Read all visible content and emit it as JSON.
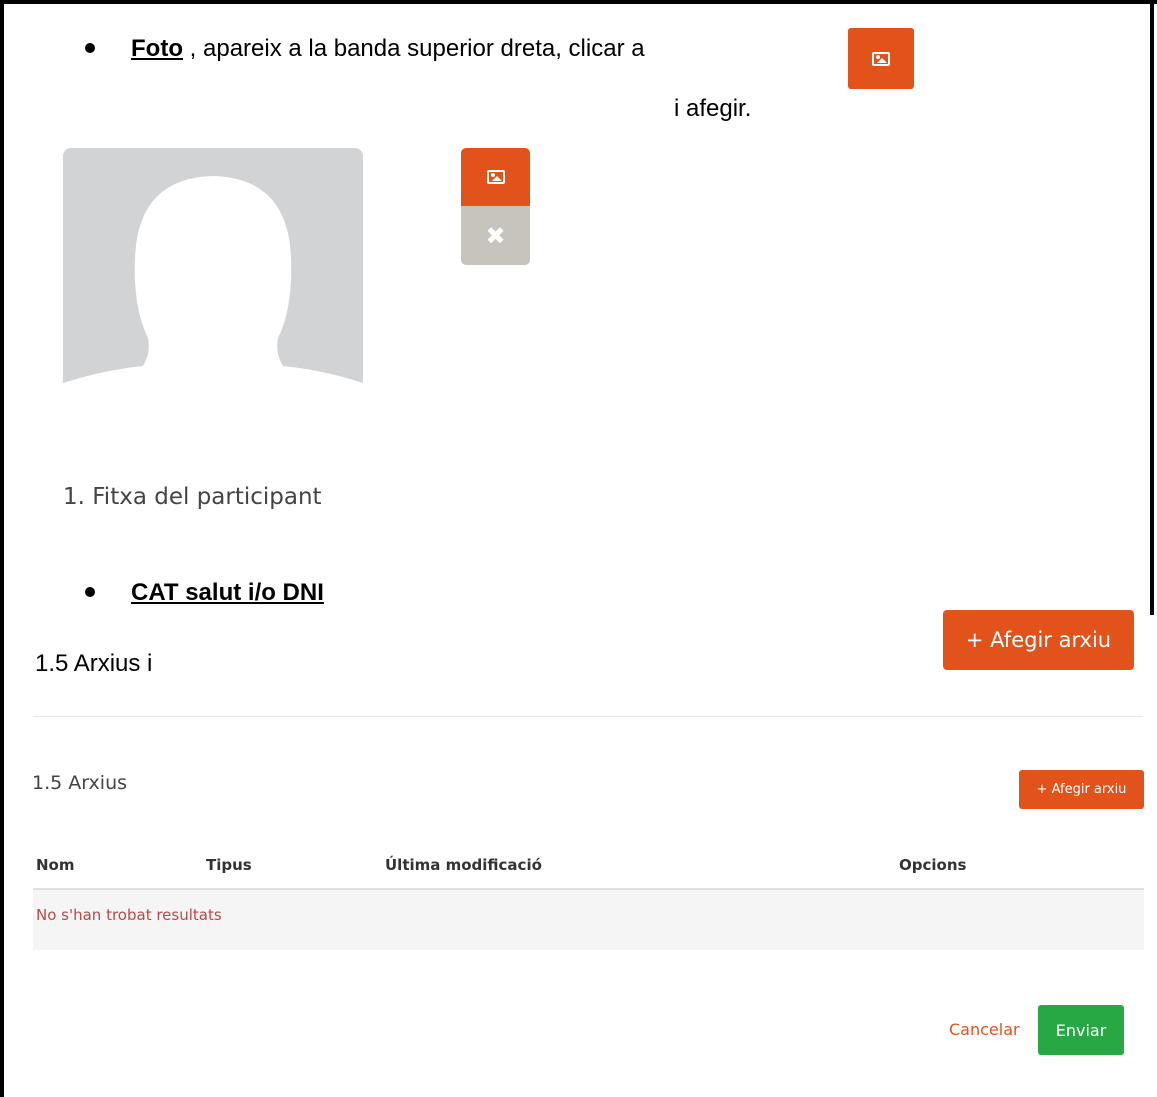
{
  "foto_bullet": {
    "label": "Foto",
    "text": ", apareix a la banda superior dreta, clicar a",
    "icon": "image-icon",
    "continuation": "i afegir."
  },
  "photo_widget": {
    "upload_icon": "image-icon",
    "remove_icon": "close-icon",
    "remove_glyph": "✖"
  },
  "section_title": "1. Fitxa del participant",
  "cat_bullet": {
    "label": "CAT salut i/o DNI"
  },
  "instruction": {
    "arxius_label": "1.5 Arxius i",
    "add_button": "+ Afegir arxiu"
  },
  "arxius_panel": {
    "title": "1.5 Arxius",
    "add_button": "+ Afegir arxiu",
    "columns": [
      "Nom",
      "Tipus",
      "Última modificació",
      "Opcions"
    ],
    "empty_message": "No s'han trobat resultats"
  },
  "footer": {
    "cancel": "Cancelar",
    "send": "Enviar"
  },
  "colors": {
    "accent": "#e2531c",
    "success": "#28a745",
    "avatar_bg": "#d2d3d5",
    "error_text": "#b94a48"
  }
}
